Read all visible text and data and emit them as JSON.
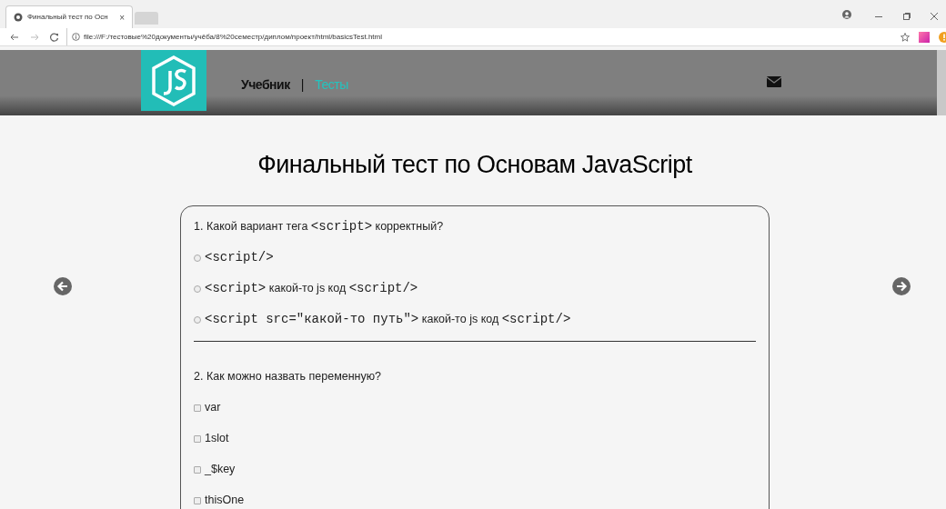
{
  "browser": {
    "tab_title": "Финальный тест по Осн",
    "tab_close": "×",
    "address": "file:///F:/тестовые%20документы/учёба/8%20семестр/диплом/проект/html/basicsTest.html"
  },
  "nav": {
    "items": [
      {
        "label": "Учебник",
        "selected": false
      },
      {
        "label": "Тесты",
        "selected": true
      }
    ],
    "separator": "|"
  },
  "title": "Финальный тест по Основам JavaScript",
  "questions": [
    {
      "text": [
        {
          "kind": "text",
          "text": "1. Какой вариант тега "
        },
        {
          "kind": "code",
          "text": "<script>"
        },
        {
          "kind": "text",
          "text": " корректный?"
        }
      ],
      "kind": "radio",
      "options": [
        {
          "checked": false,
          "parts": [
            {
              "kind": "code",
              "text": "<script/>"
            }
          ]
        },
        {
          "checked": false,
          "parts": [
            {
              "kind": "code",
              "text": "<script>"
            },
            {
              "kind": "text",
              "text": " какой-то js код "
            },
            {
              "kind": "code",
              "text": "<script/>"
            }
          ]
        },
        {
          "checked": false,
          "parts": [
            {
              "kind": "code",
              "text": "<script src=\"какой-то путь\">"
            },
            {
              "kind": "text",
              "text": " какой-то js код "
            },
            {
              "kind": "code",
              "text": "<script/>"
            }
          ]
        }
      ]
    },
    {
      "text": [
        {
          "kind": "text",
          "text": "2. Как можно назвать переменную?"
        }
      ],
      "kind": "checkbox",
      "options": [
        {
          "checked": false,
          "parts": [
            {
              "kind": "text",
              "text": "var"
            }
          ]
        },
        {
          "checked": false,
          "parts": [
            {
              "kind": "text",
              "text": "1slot"
            }
          ]
        },
        {
          "checked": false,
          "parts": [
            {
              "kind": "text",
              "text": "_$key"
            }
          ]
        },
        {
          "checked": false,
          "parts": [
            {
              "kind": "text",
              "text": "thisOne"
            }
          ]
        }
      ]
    }
  ]
}
